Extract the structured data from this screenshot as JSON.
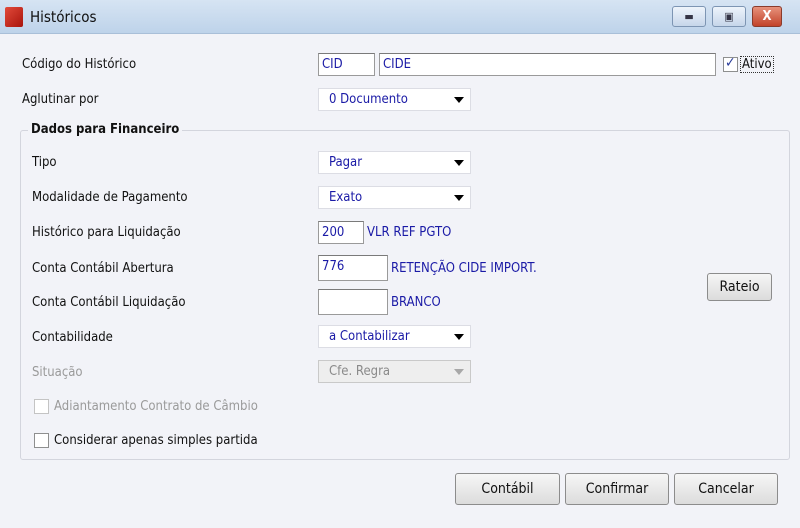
{
  "window": {
    "title": "Históricos",
    "minimize": "▬",
    "maximize": "▣",
    "close": "X"
  },
  "codigo": {
    "label": "Código do Histórico",
    "code": "CID",
    "description": "CIDE",
    "ativo_label": "Ativo",
    "ativo_checked": true
  },
  "aglutinar": {
    "label": "Aglutinar por",
    "value": "0 Documento"
  },
  "financeiro": {
    "title": "Dados para Financeiro",
    "tipo": {
      "label": "Tipo",
      "value": "Pagar"
    },
    "modalidade": {
      "label": "Modalidade de Pagamento",
      "value": "Exato"
    },
    "hist_liq": {
      "label": "Histórico para Liquidação",
      "code": "200",
      "description": "VLR REF PGTO"
    },
    "conta_abertura": {
      "label": "Conta Contábil Abertura",
      "code": "776",
      "description": "RETENÇÃO CIDE IMPORT."
    },
    "conta_liq": {
      "label": "Conta Contábil Liquidação",
      "code": "",
      "description": "BRANCO"
    },
    "contabilidade": {
      "label": "Contabilidade",
      "value": "a Contabilizar"
    },
    "situacao": {
      "label": "Situação",
      "value": "Cfe. Regra"
    },
    "adiantamento": {
      "label": "Adiantamento Contrato de Câmbio",
      "checked": false
    },
    "simples": {
      "label": "Considerar apenas simples partida",
      "checked": false
    },
    "rateio": "Rateio"
  },
  "buttons": {
    "contabil": "Contábil",
    "confirmar": "Confirmar",
    "cancelar": "Cancelar"
  }
}
